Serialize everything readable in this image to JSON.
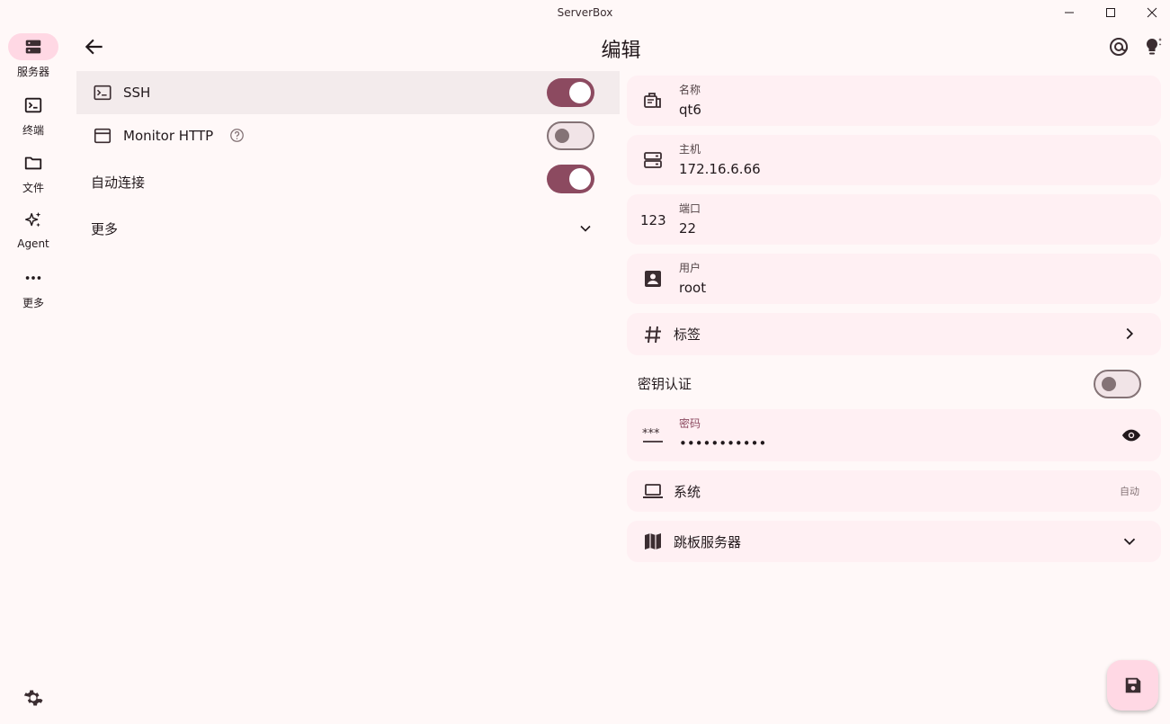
{
  "window": {
    "title": "ServerBox"
  },
  "rail": {
    "items": [
      {
        "label": "服务器",
        "icon": "server-icon",
        "active": true
      },
      {
        "label": "终端",
        "icon": "terminal-icon",
        "active": false
      },
      {
        "label": "文件",
        "icon": "folder-icon",
        "active": false
      },
      {
        "label": "Agent",
        "icon": "sparkle-icon",
        "active": false
      },
      {
        "label": "更多",
        "icon": "more-horiz-icon",
        "active": false
      }
    ],
    "settings_icon": "gear-icon"
  },
  "appbar": {
    "title": "编辑",
    "actions": [
      "at-sign-icon",
      "lightbulb-icon"
    ]
  },
  "left": {
    "ssh": {
      "label": "SSH",
      "enabled": true
    },
    "monitor_http": {
      "label": "Monitor HTTP",
      "enabled": false
    },
    "auto_connect": {
      "label": "自动连接",
      "enabled": true
    },
    "more": {
      "label": "更多"
    }
  },
  "form": {
    "name": {
      "label": "名称",
      "value": "qt6"
    },
    "host": {
      "label": "主机",
      "value": "172.16.6.66"
    },
    "port": {
      "label": "端口",
      "value": "22",
      "icon_text": "123"
    },
    "user": {
      "label": "用户",
      "value": "root"
    },
    "tags": {
      "label": "标签"
    },
    "key_auth": {
      "label": "密钥认证",
      "enabled": false
    },
    "password": {
      "label": "密码",
      "value": "•••••••••••"
    },
    "system": {
      "label": "系统",
      "value": "自动"
    },
    "jump_server": {
      "label": "跳板服务器"
    }
  },
  "colors": {
    "primary": "#8c4a60",
    "surface": "#fff8f8",
    "card": "#fff0f3",
    "active_pill": "#ffd8e4",
    "selected_row": "#f3ebec"
  }
}
